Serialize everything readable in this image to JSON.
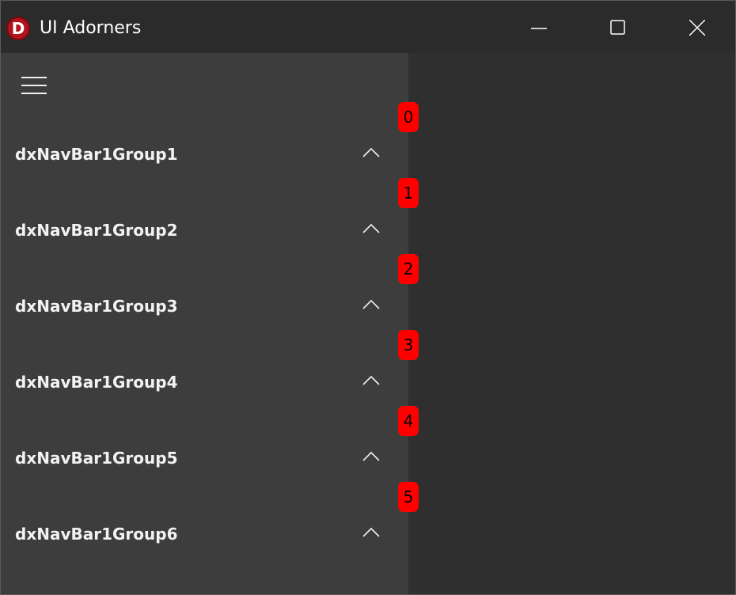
{
  "window": {
    "title": "UI Adorners",
    "app_icon_letter": "D"
  },
  "navbar": {
    "menu_icon": "hamburger-icon",
    "groups": [
      {
        "label": "dxNavBar1Group1",
        "chevron": "chevron-up-icon"
      },
      {
        "label": "dxNavBar1Group2",
        "chevron": "chevron-up-icon"
      },
      {
        "label": "dxNavBar1Group3",
        "chevron": "chevron-up-icon"
      },
      {
        "label": "dxNavBar1Group4",
        "chevron": "chevron-up-icon"
      },
      {
        "label": "dxNavBar1Group5",
        "chevron": "chevron-up-icon"
      },
      {
        "label": "dxNavBar1Group6",
        "chevron": "chevron-up-icon"
      }
    ]
  },
  "adorners": [
    "0",
    "1",
    "2",
    "3",
    "4",
    "5"
  ],
  "colors": {
    "titlebar": "#2b2b2b",
    "navbar": "#3d3d3d",
    "content": "#2f2f2f",
    "adorner": "#ff0000",
    "text": "#f2f2f2"
  }
}
